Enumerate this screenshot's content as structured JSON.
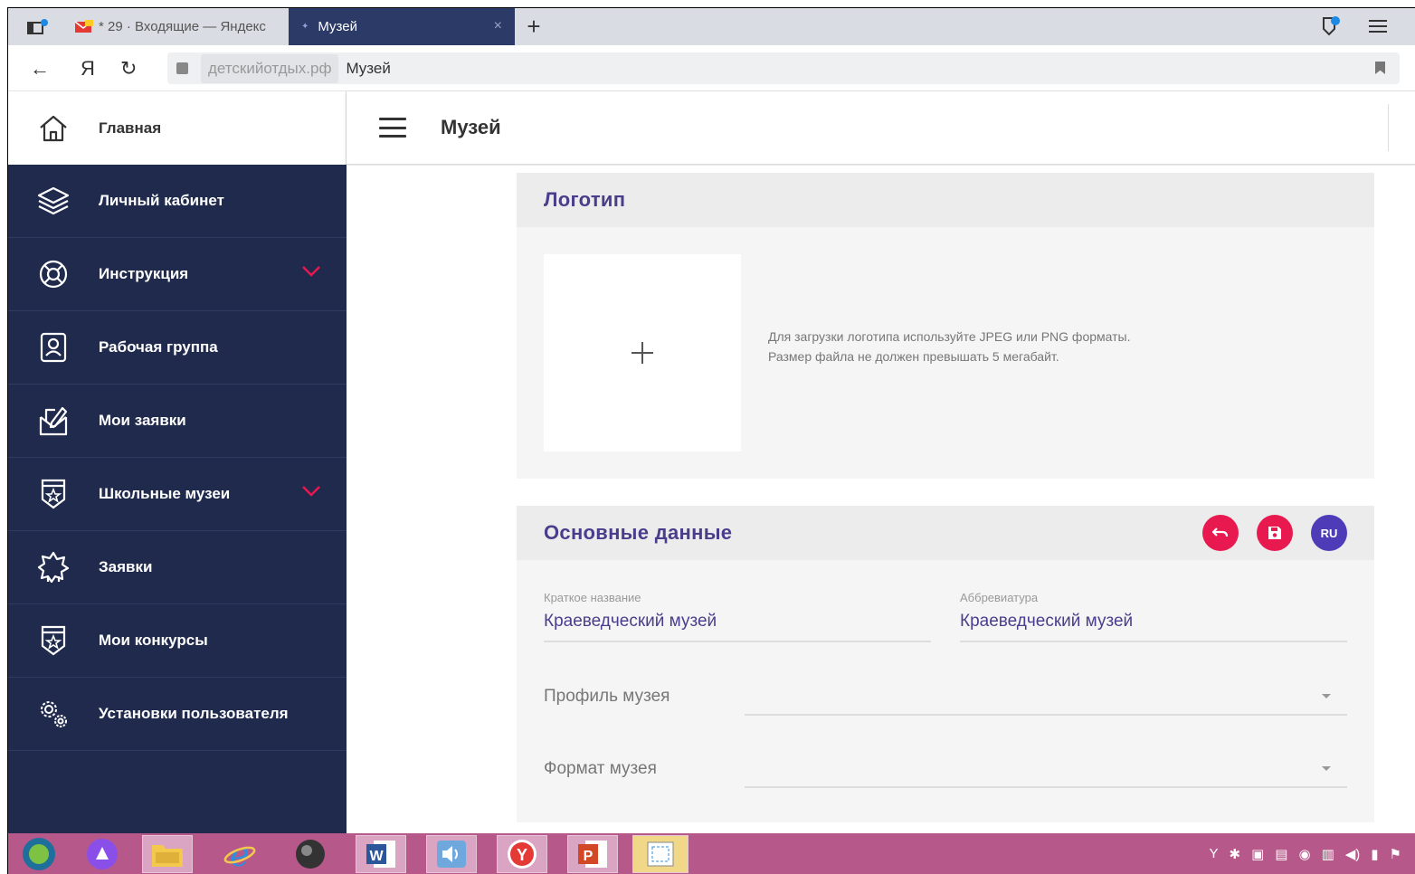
{
  "browser": {
    "tabs": [
      {
        "label": "* 29 · Входящие — Яндекс",
        "active": false
      },
      {
        "label": "Музей",
        "active": true
      }
    ],
    "new_tab_symbol": "+",
    "close_symbol": "×",
    "yandex_button": "Я",
    "url_domain": "детскийотдых.рф",
    "url_page": "Музей"
  },
  "sidebar": {
    "home_label": "Главная",
    "items": [
      {
        "label": "Личный кабинет",
        "icon": "layers-icon",
        "expandable": false
      },
      {
        "label": "Инструкция",
        "icon": "lifebuoy-icon",
        "expandable": true
      },
      {
        "label": "Рабочая группа",
        "icon": "user-badge-icon",
        "expandable": false
      },
      {
        "label": "Мои заявки",
        "icon": "envelope-edit-icon",
        "expandable": false
      },
      {
        "label": "Школьные музеи",
        "icon": "star-shield-icon",
        "expandable": true
      },
      {
        "label": "Заявки",
        "icon": "badge-star-icon",
        "expandable": false
      },
      {
        "label": "Мои конкурсы",
        "icon": "star-shield-icon",
        "expandable": false
      },
      {
        "label": "Установки пользователя",
        "icon": "gears-icon",
        "expandable": false
      }
    ]
  },
  "header": {
    "title": "Музей"
  },
  "logo_section": {
    "title": "Логотип",
    "add_symbol": "+",
    "hint_line1": "Для загрузки логотипа используйте JPEG или PNG форматы.",
    "hint_line2": "Размер файла не должен превышать 5 мегабайт."
  },
  "main_section": {
    "title": "Основные данные",
    "lang_button": "RU",
    "short_name_label": "Краткое название",
    "short_name_value": "Краеведческий музей",
    "abbr_label": "Аббревиатура",
    "abbr_value": "Краеведческий музей",
    "profile_label": "Профиль музея",
    "format_label": "Формат музея"
  },
  "colors": {
    "sidebar_bg": "#1f2a4d",
    "accent_red": "#e8194f",
    "accent_purple": "#4e3bb8",
    "heading_purple": "#4a3e8c",
    "taskbar": "#b6598a"
  }
}
